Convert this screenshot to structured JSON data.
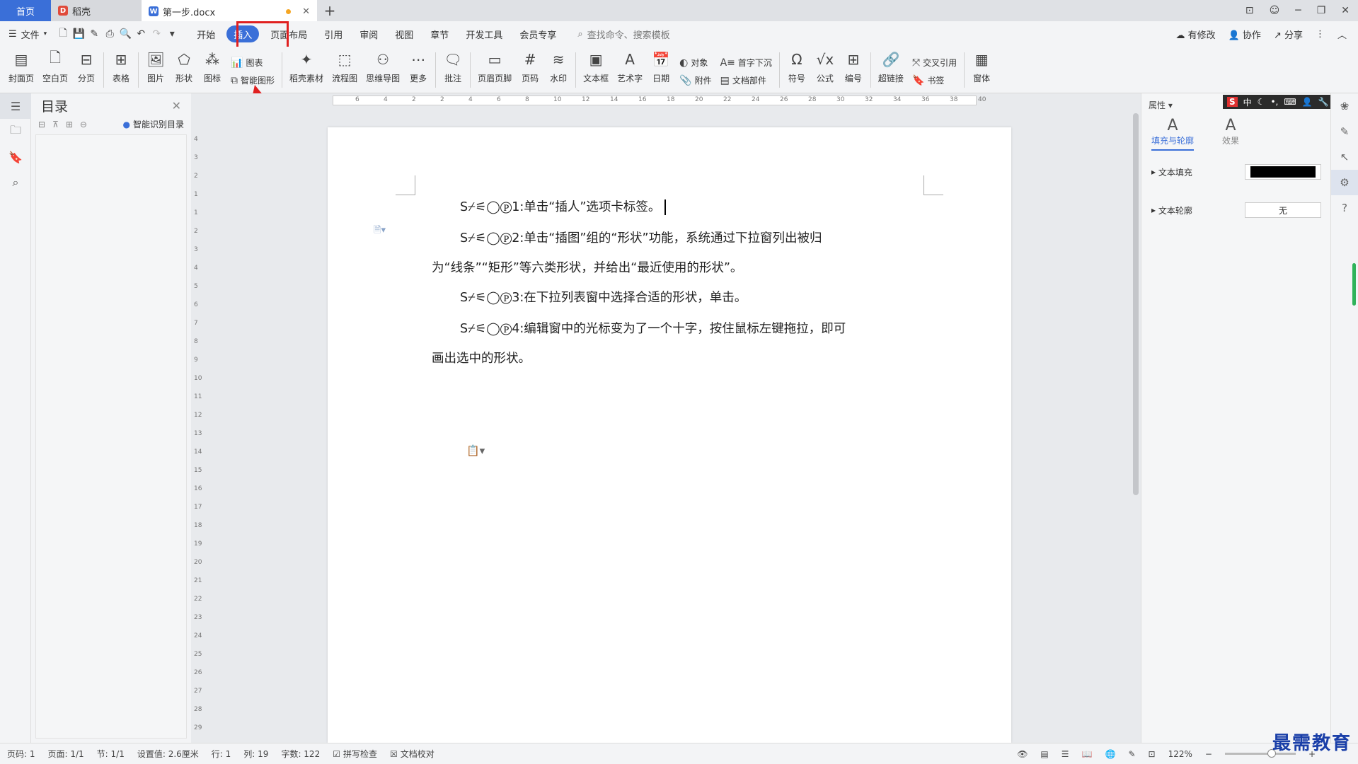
{
  "tabs": {
    "home": "首页",
    "t1": "稻壳",
    "t2": "第一步.docx",
    "add": "+"
  },
  "menubar": {
    "file": "文件",
    "tabs": [
      "开始",
      "插入",
      "页面布局",
      "引用",
      "审阅",
      "视图",
      "章节",
      "开发工具",
      "会员专享"
    ],
    "search": "查找命令、搜索模板",
    "right": [
      "有修改",
      "协作",
      "分享"
    ]
  },
  "ribbon": {
    "items": [
      "封面页",
      "空白页",
      "分页",
      "表格",
      "图片",
      "形状",
      "图标",
      "稻壳素材",
      "流程图",
      "思维导图",
      "更多",
      "批注",
      "页眉页脚",
      "页码",
      "水印",
      "文本框",
      "艺术字",
      "日期",
      "符号",
      "公式",
      "编号",
      "超链接",
      "窗体"
    ],
    "small": {
      "chart": "图表",
      "smartart": "智能图形",
      "object": "对象",
      "attach": "附件",
      "dropcap": "首字下沉",
      "docpart": "文档部件",
      "crossref": "交叉引用",
      "bookmark": "书签"
    }
  },
  "toc": {
    "title": "目录",
    "smart": "智能识别目录"
  },
  "doc": {
    "p1": "S⌿⚟◯Ⓟ1:单击“插人”选项卡标签。",
    "p2a": "S⌿⚟◯Ⓟ2:单击“插图”组的“形状”功能，系统通过下拉窗列出被归",
    "p2b": "为“线条”“矩形”等六类形状，并给出“最近使用的形状”。",
    "p3": "S⌿⚟◯Ⓟ3:在下拉列表窗中选择合适的形状，单击。",
    "p4a": "S⌿⚟◯Ⓟ4:编辑窗中的光标变为了一个十字，按住鼠标左键拖拉，即可",
    "p4b": "画出选中的形状。"
  },
  "props": {
    "title": "属性",
    "tab1": "填充与轮廓",
    "tab2": "效果",
    "fill": "文本填充",
    "outline": "文本轮廓",
    "outline_val": "无",
    "fill_color": "#000000"
  },
  "ime": {
    "s": "S",
    "lang": "中"
  },
  "status": {
    "page": "页码: 1",
    "pages": "页面: 1/1",
    "section": "节: 1/1",
    "setting": "设置值: 2.6厘米",
    "row": "行: 1",
    "col": "列: 19",
    "words": "字数: 122",
    "spell": "拼写检查",
    "proof": "文档校对",
    "zoom": "122%"
  },
  "watermark": "最需教育",
  "accent": "#3a6fd8",
  "highlight": "#e02020"
}
